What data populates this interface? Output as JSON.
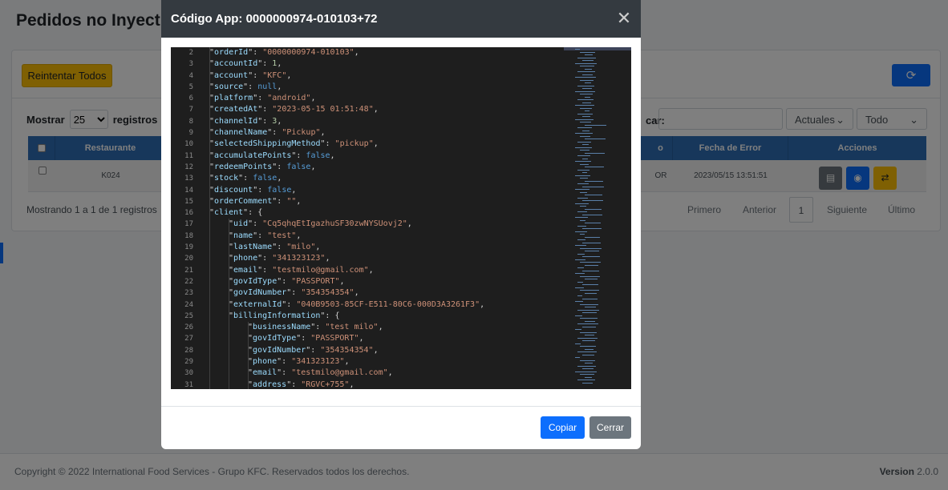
{
  "page": {
    "title": "Pedidos no Inyect",
    "retry_all_label": "Reintentar Todos",
    "refresh_icon": "refresh-icon",
    "show_label": "Mostrar",
    "show_value": "25",
    "records_label": "registros",
    "search_label": "car:",
    "filter1": "Actuales",
    "filter2": "Todo",
    "table": {
      "columns": [
        "Restaurante",
        "",
        "Fecha de Error",
        "Acciones"
      ],
      "rows": [
        {
          "restaurant": "K024",
          "status_frag": "OR",
          "error_date": "2023/05/15 13:51:51"
        }
      ]
    },
    "showing_text": "Mostrando 1 a 1 de 1 registros",
    "pager": {
      "first": "Primero",
      "prev": "Anterior",
      "current": "1",
      "next": "Siguiente",
      "last": "Último"
    }
  },
  "footer": {
    "copyright": "Copyright © 2022 International Food Services - Grupo KFC. Reservados todos los derechos.",
    "version_label": "Version",
    "version_value": "2.0.0"
  },
  "modal": {
    "title": "Código App: 0000000974-010103+72",
    "copy_label": "Copiar",
    "close_label": "Cerrar",
    "code_lines": [
      {
        "n": "2",
        "indent": 1,
        "key": "orderId",
        "val": "\"0000000974-010103\"",
        "type": "s"
      },
      {
        "n": "3",
        "indent": 1,
        "key": "accountId",
        "val": "1",
        "type": "n"
      },
      {
        "n": "4",
        "indent": 1,
        "key": "account",
        "val": "\"KFC\"",
        "type": "s"
      },
      {
        "n": "5",
        "indent": 1,
        "key": "source",
        "val": "null",
        "type": "kw"
      },
      {
        "n": "6",
        "indent": 1,
        "key": "platform",
        "val": "\"android\"",
        "type": "s"
      },
      {
        "n": "7",
        "indent": 1,
        "key": "createdAt",
        "val": "\"2023-05-15 01:51:48\"",
        "type": "s"
      },
      {
        "n": "8",
        "indent": 1,
        "key": "channelId",
        "val": "3",
        "type": "n"
      },
      {
        "n": "9",
        "indent": 1,
        "key": "channelName",
        "val": "\"Pickup\"",
        "type": "s"
      },
      {
        "n": "10",
        "indent": 1,
        "key": "selectedShippingMethod",
        "val": "\"pickup\"",
        "type": "s"
      },
      {
        "n": "11",
        "indent": 1,
        "key": "accumulatePoints",
        "val": "false",
        "type": "kw"
      },
      {
        "n": "12",
        "indent": 1,
        "key": "redeemPoints",
        "val": "false",
        "type": "kw"
      },
      {
        "n": "13",
        "indent": 1,
        "key": "stock",
        "val": "false",
        "type": "kw"
      },
      {
        "n": "14",
        "indent": 1,
        "key": "discount",
        "val": "false",
        "type": "kw"
      },
      {
        "n": "15",
        "indent": 1,
        "key": "orderComment",
        "val": "\"\"",
        "type": "s"
      },
      {
        "n": "16",
        "indent": 1,
        "key": "client",
        "val": "{",
        "type": "p",
        "open": true
      },
      {
        "n": "17",
        "indent": 2,
        "key": "uid",
        "val": "\"Cq5qhqEtIgazhuSF30zwNYSUovj2\"",
        "type": "s"
      },
      {
        "n": "18",
        "indent": 2,
        "key": "name",
        "val": "\"test\"",
        "type": "s"
      },
      {
        "n": "19",
        "indent": 2,
        "key": "lastName",
        "val": "\"milo\"",
        "type": "s"
      },
      {
        "n": "20",
        "indent": 2,
        "key": "phone",
        "val": "\"341323123\"",
        "type": "s"
      },
      {
        "n": "21",
        "indent": 2,
        "key": "email",
        "val": "\"testmilo@gmail.com\"",
        "type": "s"
      },
      {
        "n": "22",
        "indent": 2,
        "key": "govIdType",
        "val": "\"PASSPORT\"",
        "type": "s"
      },
      {
        "n": "23",
        "indent": 2,
        "key": "govIdNumber",
        "val": "\"354354354\"",
        "type": "s"
      },
      {
        "n": "24",
        "indent": 2,
        "key": "externalId",
        "val": "\"040B9503-85CF-E511-80C6-000D3A3261F3\"",
        "type": "s"
      },
      {
        "n": "25",
        "indent": 2,
        "key": "billingInformation",
        "val": "{",
        "type": "p",
        "open": true
      },
      {
        "n": "26",
        "indent": 3,
        "key": "businessName",
        "val": "\"test milo\"",
        "type": "s"
      },
      {
        "n": "27",
        "indent": 3,
        "key": "govIdType",
        "val": "\"PASSPORT\"",
        "type": "s"
      },
      {
        "n": "28",
        "indent": 3,
        "key": "govIdNumber",
        "val": "\"354354354\"",
        "type": "s"
      },
      {
        "n": "29",
        "indent": 3,
        "key": "phone",
        "val": "\"341323123\"",
        "type": "s"
      },
      {
        "n": "30",
        "indent": 3,
        "key": "email",
        "val": "\"testmilo@gmail.com\"",
        "type": "s"
      },
      {
        "n": "31",
        "indent": 3,
        "key": "address",
        "val": "\"RGVC+755\"",
        "type": "s"
      }
    ]
  },
  "colors": {
    "modal_header": "#343a40",
    "primary": "#0d6efd",
    "secondary": "#6c757d",
    "warning": "#ffc107",
    "table_header": "#2f6fb6"
  }
}
